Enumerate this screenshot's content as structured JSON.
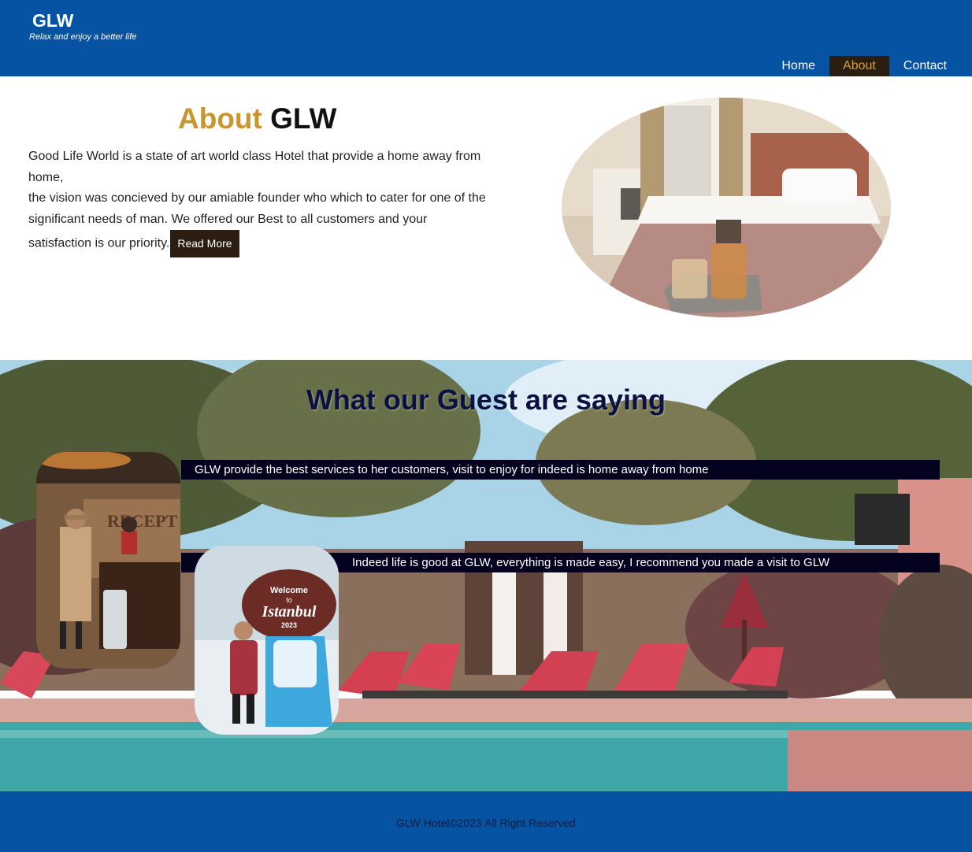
{
  "header": {
    "brand": "GLW",
    "tagline": "Relax and enjoy a better life",
    "nav": [
      {
        "label": "Home"
      },
      {
        "label": "About"
      },
      {
        "label": "Contact"
      }
    ],
    "active_nav": "About"
  },
  "about": {
    "title_accent": "About",
    "title_rest": "GLW",
    "paragraph_line1": "Good Life World is a state of art world class Hotel that provide a home away from home,",
    "paragraph_line2": "the vision was concieved by our amiable founder who which to cater for one of the significant needs of man. We offered our Best to all customers and your satisfaction is our priority.",
    "read_more_label": "Read More"
  },
  "testimonials": {
    "title": "What our Guest are saying",
    "quotes": [
      {
        "text": "GLW provide the best services to her customers, visit to enjoy for indeed is home away from home"
      },
      {
        "text": "Indeed life is good at GLW, everything is made easy, I recommend you made a visit to GLW"
      }
    ],
    "photo_signage": {
      "reception_sign": "RECEPT",
      "welcome_sign_line1": "Welcome",
      "welcome_sign_line2": "to",
      "welcome_sign_line3": "Istanbul",
      "welcome_sign_line4": "2023"
    }
  },
  "footer": {
    "copyright": "GLW Hotel©2023 All Right Reserved"
  },
  "colors": {
    "header_bg": "#0652a3",
    "accent": "#c8952f",
    "dark_button": "#2b1e10",
    "quote_bar": "#05021f"
  }
}
